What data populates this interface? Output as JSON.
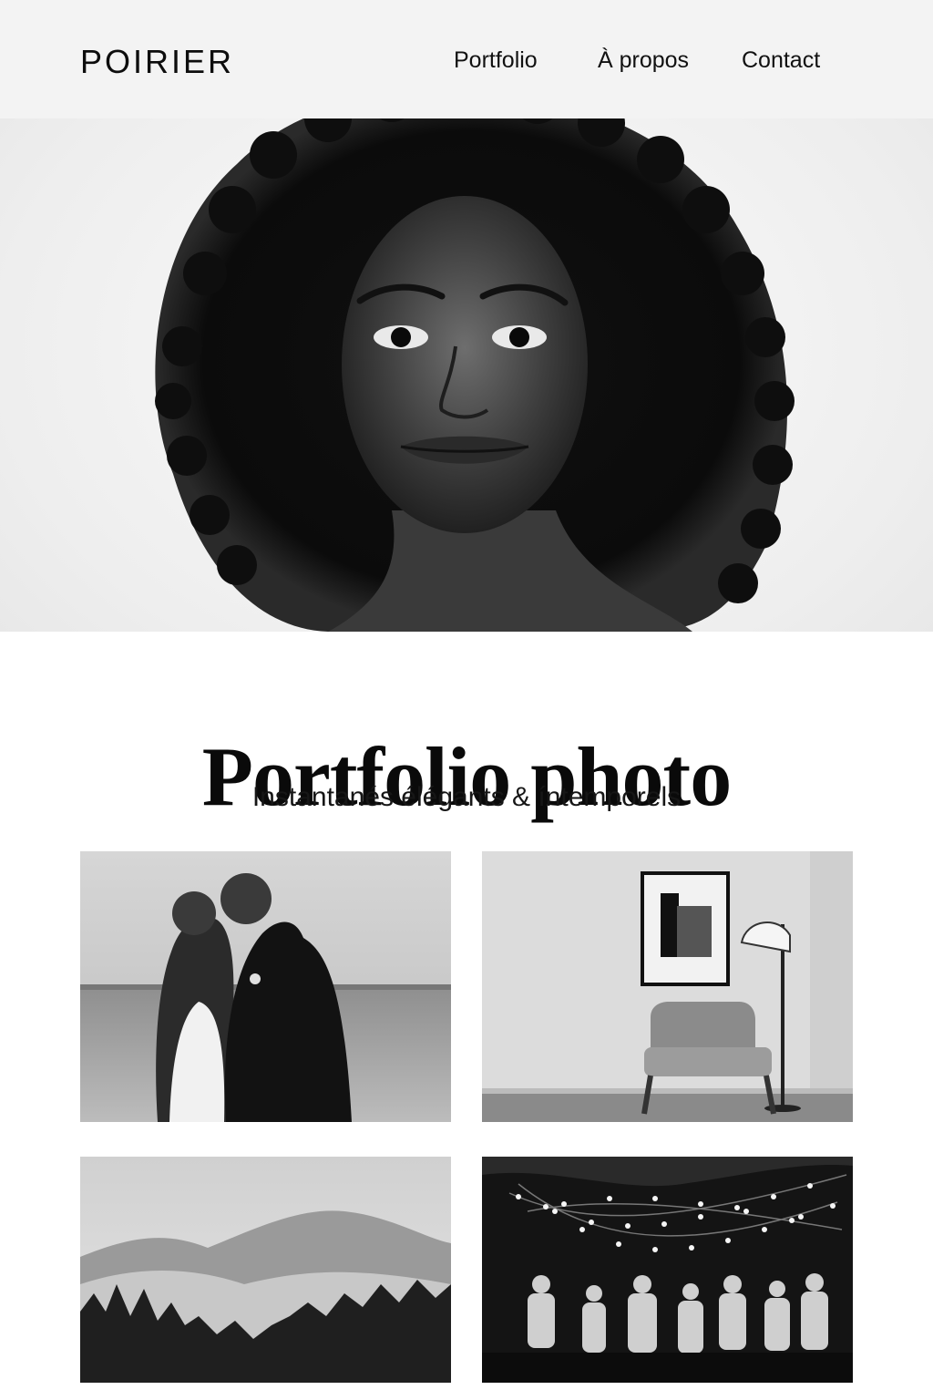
{
  "header": {
    "logo": "POIRIER",
    "nav": [
      {
        "label": "Portfolio"
      },
      {
        "label": "À propos"
      },
      {
        "label": "Contact"
      }
    ]
  },
  "main": {
    "title": "Portfolio photo",
    "subtitle": "Instantanés élégants & íntemporels"
  },
  "colors": {
    "background": "#ffffff",
    "text": "#111111",
    "header_bg": "#f3f3f3"
  }
}
